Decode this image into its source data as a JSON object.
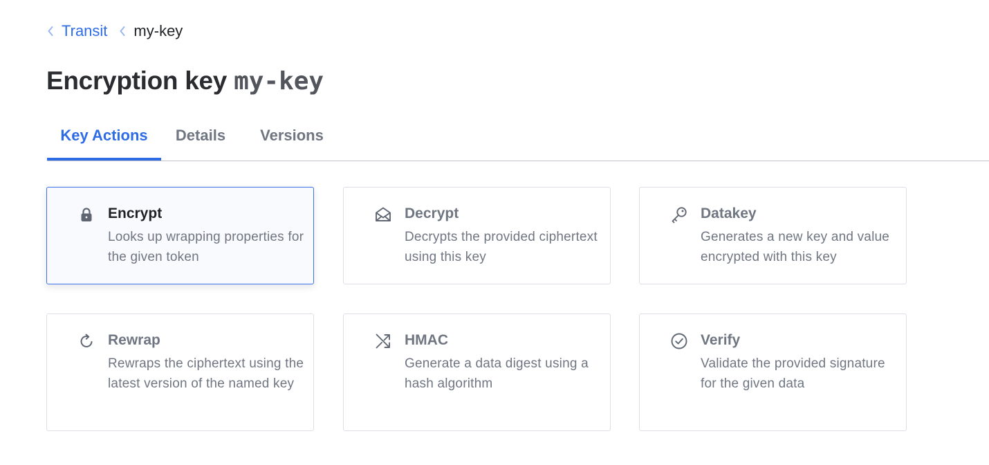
{
  "breadcrumb": {
    "items": [
      {
        "label": "Transit",
        "link": true
      },
      {
        "label": "my-key",
        "link": false
      }
    ]
  },
  "title": {
    "main": "Encryption key",
    "key_name": "my-key"
  },
  "tabs": [
    {
      "label": "Key Actions",
      "active": true
    },
    {
      "label": "Details",
      "active": false
    },
    {
      "label": "Versions",
      "active": false
    }
  ],
  "actions": [
    {
      "title": "Encrypt",
      "description": "Looks up wrapping properties for the given token",
      "icon": "lock-icon",
      "selected": true
    },
    {
      "title": "Decrypt",
      "description": "Decrypts the provided ciphertext using this key",
      "icon": "envelope-open-icon",
      "selected": false
    },
    {
      "title": "Datakey",
      "description": "Generates a new key and value encrypted with this key",
      "icon": "key-icon",
      "selected": false
    },
    {
      "title": "Rewrap",
      "description": "Rewraps the ciphertext using the latest version of the named key",
      "icon": "rotate-icon",
      "selected": false
    },
    {
      "title": "HMAC",
      "description": "Generate a data digest using a hash algorithm",
      "icon": "shuffle-icon",
      "selected": false
    },
    {
      "title": "Verify",
      "description": "Validate the provided signature for the given data",
      "icon": "check-circle-icon",
      "selected": false
    }
  ],
  "colors": {
    "accent": "#2e6ce6",
    "muted_text": "#6f7682",
    "border": "#dce0e6",
    "breadcrumb_chevron": "#9bb6f0"
  }
}
